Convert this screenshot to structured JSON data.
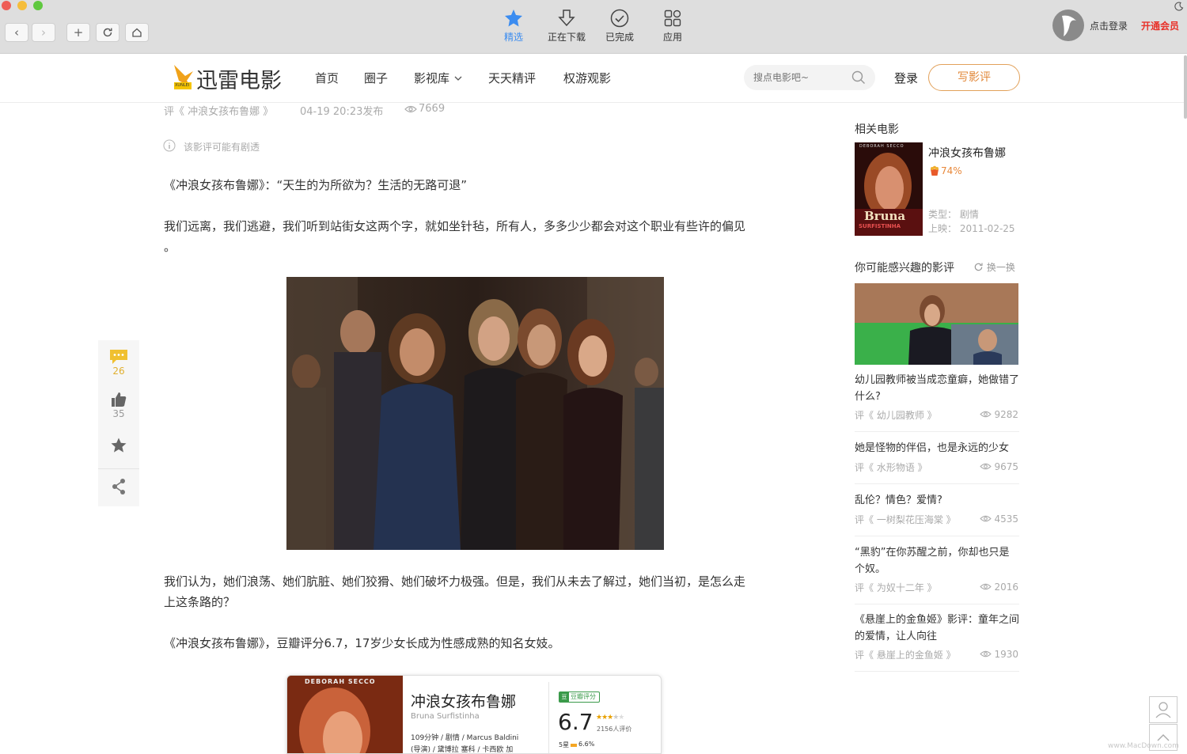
{
  "chrome": {
    "tabs": [
      {
        "label": "精选",
        "icon": "featured-star-icon"
      },
      {
        "label": "正在下载",
        "icon": "download-icon"
      },
      {
        "label": "已完成",
        "icon": "check-circle-icon"
      },
      {
        "label": "应用",
        "icon": "apps-grid-icon"
      }
    ],
    "login_label": "点击登录",
    "vip_label": "开通会员",
    "colors": {
      "active_tab": "#3b8cf0",
      "vip": "#e8322a"
    }
  },
  "site": {
    "logo_text": "迅雷电影",
    "logo_small": "XUNLEI",
    "nav": [
      "首页",
      "圈子",
      "影视库",
      "天天精评",
      "权游观影"
    ],
    "search_placeholder": "搜点电影吧~",
    "login": "登录",
    "write_review": "写影评",
    "accent": "#e2883a"
  },
  "article": {
    "source": "评《 冲浪女孩布鲁娜 》",
    "published": "04-19 20:23发布",
    "views": "7669",
    "spoiler_note": "该影评可能有剧透",
    "p1": "《冲浪女孩布鲁娜》：“天生的为所欲为？生活的无路可退”",
    "p2a": "我们远离，我们逃避，我们听到站街女这两个字，就如坐针毡，所有人，多多少少都会对这个职业有些许的偏见",
    "p2b": "。",
    "p3a": "我们认为，她们浪荡、她们肮脏、她们狡猾、她们破坏力极强。但是，我们从未去了解过，她们当初，是怎么走",
    "p3b": "上这条路的？",
    "p4": "《冲浪女孩布鲁娜》，豆瓣评分6.7，17岁少女长成为性感成熟的知名女妓。",
    "card": {
      "poster_caption": "DEBORAH SECCO",
      "title": "冲浪女孩布鲁娜",
      "subtitle": "Bruna Surfistinha",
      "info1": "109分钟 / 剧情 / Marcus Baldini",
      "info2": "(导演) / 黛博拉 塞科 / 卡西欧 加",
      "douban_badge": "豆瓣评分",
      "score": "6.7",
      "rating_count": "2156人评价",
      "star5": "5星",
      "star5_pct": "6.6%"
    }
  },
  "actions": {
    "comments": "26",
    "likes": "35"
  },
  "sidebar": {
    "related_title": "相关电影",
    "movie": {
      "title": "冲浪女孩布鲁娜",
      "score": "74%",
      "poster_top": "DEBORAH SECCO",
      "poster_name": "Bruna",
      "poster_sub": "SURFISTINHA",
      "genre": "类型：  剧情",
      "release": "上映：  2011-02-25"
    },
    "interest_title": "你可能感兴趣的影评",
    "refresh": "换一换",
    "reviews": [
      {
        "title": "幼儿园教师被当成恋童癖，她做错了什么?",
        "source": "评《 幼儿园教师 》",
        "views": "9282"
      },
      {
        "title": "她是怪物的伴侣，也是永远的少女",
        "source": "评《 水形物语 》",
        "views": "9675"
      },
      {
        "title": "乱伦？情色？爱情?",
        "source": "评《 一树梨花压海棠 》",
        "views": "4535"
      },
      {
        "title": "“黑豹”在你苏醒之前，你却也只是个奴。",
        "source": "评《 为奴十二年 》",
        "views": "2016"
      },
      {
        "title": "《悬崖上的金鱼姬》影评：童年之间的爱情，让人向往",
        "source": "评《 悬崖上的金鱼姬 》",
        "views": "1930"
      }
    ]
  },
  "watermark": "www.MacDown.com"
}
